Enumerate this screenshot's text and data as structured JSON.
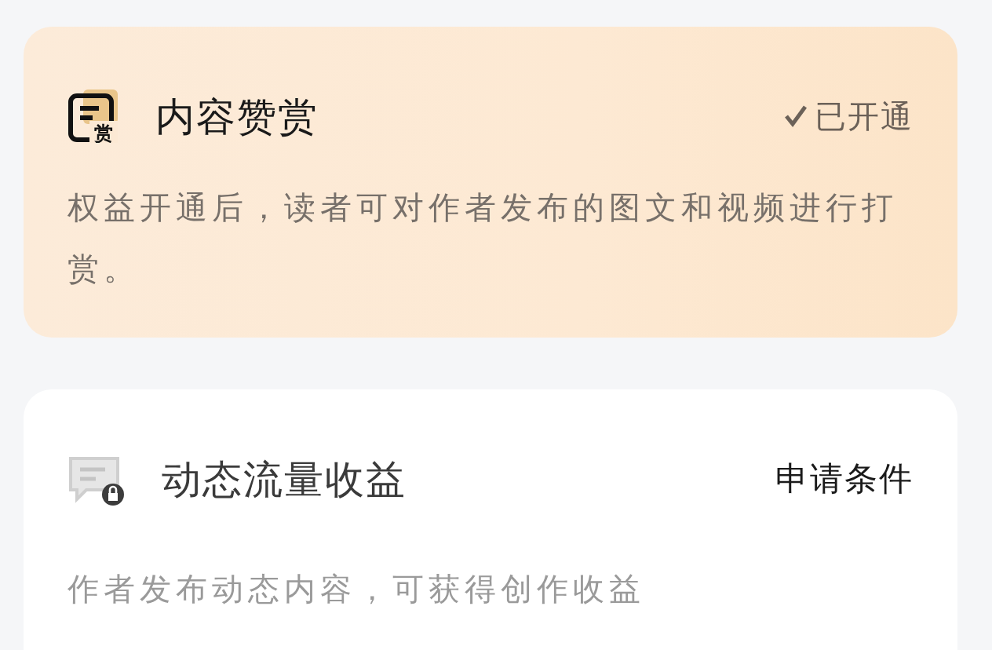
{
  "benefits": [
    {
      "kind": "unlocked",
      "title": "内容赞赏",
      "status": "已开通",
      "description": "权益开通后，读者可对作者发布的图文和视频进行打赏。",
      "icon_label": "赏"
    },
    {
      "kind": "locked",
      "title": "动态流量收益",
      "action": "申请条件",
      "description": "作者发布动态内容，可获得创作收益"
    }
  ]
}
